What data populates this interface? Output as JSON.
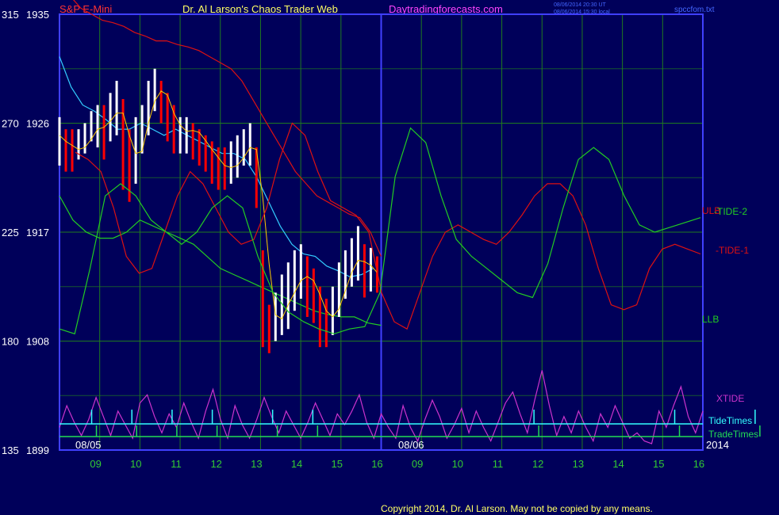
{
  "header": {
    "symbol": "S&P E-Mini",
    "title": "Dr. Al Larson's Chaos Trader Web",
    "site": "Daytradingforecasts.com",
    "stamp_utc": "08/06/2014 20:30 UT",
    "stamp_local": "08/06/2014 15:30 local",
    "file": "spccfom.txt"
  },
  "footer": {
    "copyright": "Copyright 2014, Dr. Al Larson. May not be copied by any means."
  },
  "colors": {
    "background": "#00005a",
    "grid": "#1f7a1f",
    "axis": "#4040ff",
    "upper_band": "#dd1111",
    "lower_band": "#22cc22",
    "ma_cyan": "#33ccff",
    "ma_yellow": "#ffcc00",
    "price_up": "#ffffff",
    "price_down": "#ff0000",
    "xtide": "#cc33cc",
    "tide_times": "#33ffff",
    "trade_times": "#22dd55",
    "symbol_text": "#ff3333",
    "title_text": "#ffff66",
    "site_text": "#ff44ff",
    "axis_label_text": "#ffffff"
  },
  "chart_data": {
    "type": "line",
    "y_axis_left_osc": [
      315,
      270,
      225,
      180,
      135
    ],
    "y_axis_price": [
      1935,
      1926,
      1917,
      1908,
      1899
    ],
    "ylim": [
      1899,
      1935
    ],
    "x_hour_ticks": [
      "09",
      "10",
      "11",
      "12",
      "13",
      "14",
      "15",
      "16",
      "09",
      "10",
      "11",
      "12",
      "13",
      "14",
      "15",
      "16"
    ],
    "date_labels": [
      "08/05",
      "08/06"
    ],
    "year_label": "2014",
    "series_labels": {
      "ulb": "ULB",
      "tide2": "-TIDE-2",
      "tide1": "-TIDE-1",
      "llb": "LLB",
      "xtide": "XTIDE",
      "tide_times": "TideTimes",
      "trade_times": "TradeTimes"
    },
    "hour_index_x": [
      0,
      0.5,
      1,
      1.5,
      2,
      2.5,
      3,
      3.5,
      4,
      4.5,
      5,
      5.5,
      6,
      6.5,
      7,
      7.5,
      8,
      8.5,
      9,
      9.5,
      10,
      10.5,
      11,
      11.5,
      12,
      12.5,
      13,
      13.5,
      14,
      14.5,
      15,
      15.5,
      16,
      16.5,
      17,
      17.5,
      18,
      18.5,
      19,
      19.5,
      20,
      20.5,
      21,
      21.5,
      22,
      22.5,
      23,
      23.5,
      24,
      24.5,
      25,
      25.5,
      26,
      26.5,
      27,
      27.5,
      28,
      28.5,
      29,
      29.5,
      30,
      30.5,
      31,
      31.5,
      32
    ],
    "upper_band": [
      1937,
      1936.5,
      1935.5,
      1935,
      1934.5,
      1934.3,
      1934,
      1933.5,
      1933.2,
      1932.8,
      1932.8,
      1932.5,
      1932.3,
      1932,
      1931.5,
      1931,
      1930.5,
      1929.5,
      1928,
      1926.5,
      1925,
      1923.5,
      1922,
      1921,
      1920,
      1919.5,
      1919,
      1918.5,
      1918.2,
      1917,
      1915
    ],
    "lower_band": [
      1920,
      1918,
      1917,
      1916.5,
      1916.5,
      1917,
      1918,
      1917.5,
      1917,
      1916.5,
      1916,
      1915,
      1914,
      1913.5,
      1913,
      1912.5,
      1912,
      1911.5,
      1911,
      1910.5,
      1910.2,
      1910,
      1910,
      1909.5,
      1909.3
    ],
    "ma_cyan": [
      1931.5,
      1929,
      1927.5,
      1927,
      1926.3,
      1925.5,
      1925.5,
      1926,
      1925.5,
      1925,
      1925.5,
      1925,
      1924.5,
      1924,
      1923.5,
      1923.5,
      1923,
      1921.5,
      1919.5,
      1917.5,
      1916,
      1915.2,
      1915,
      1914.2,
      1913.8,
      1913.3,
      1913.5,
      1914
    ],
    "price_close": [
      1925,
      1924,
      1923.5,
      1924,
      1924.5,
      1925.5,
      1926.5,
      1925,
      1927,
      1928.5,
      1925,
      1921.5,
      1924,
      1925.5,
      1928.5,
      1929.5,
      1928,
      1927.5,
      1925,
      1925,
      1926,
      1925.2,
      1924.5,
      1924,
      1923,
      1922.5,
      1922,
      1922.5,
      1923,
      1924,
      1925,
      1922.5,
      1912,
      1908.5,
      1910,
      1911,
      1912,
      1913,
      1914,
      1913,
      1912,
      1910.5,
      1909,
      1910.5,
      1912.5,
      1913.5,
      1915,
      1915.5,
      1913.2,
      1914.1,
      1913.7
    ],
    "price_low": [
      1922.5,
      1922,
      1922,
      1923,
      1923.5,
      1924.5,
      1924,
      1923,
      1924.5,
      1925,
      1920.5,
      1919.5,
      1921,
      1923.5,
      1925,
      1927,
      1926,
      1924.5,
      1923.5,
      1923.5,
      1923.5,
      1923,
      1922.5,
      1922,
      1921,
      1920.5,
      1920.5,
      1921,
      1921.5,
      1922.5,
      1922.5,
      1919,
      1907.5,
      1907,
      1908,
      1908.5,
      1909,
      1910.5,
      1911.5,
      1910,
      1909.5,
      1907.5,
      1907.5,
      1908.5,
      1910,
      1911.5,
      1912.5,
      1913,
      1911.6,
      1912.1,
      1912
    ],
    "price_high": [
      1926.5,
      1925.5,
      1925.5,
      1925.5,
      1926,
      1927,
      1927.5,
      1927.5,
      1928.5,
      1929.5,
      1928,
      1925.5,
      1926.5,
      1927.5,
      1929.5,
      1930.5,
      1929.5,
      1928.5,
      1927.5,
      1926.5,
      1926.5,
      1926,
      1925.5,
      1925,
      1924.5,
      1924,
      1924,
      1924.5,
      1925,
      1925.5,
      1926,
      1924,
      1915.5,
      1911,
      1912,
      1913.5,
      1914.5,
      1915.5,
      1916,
      1915,
      1914,
      1912.5,
      1911.5,
      1912.5,
      1914.5,
      1915.5,
      1916.5,
      1917.5,
      1916,
      1915.7,
      1915
    ],
    "tide1_osc": [
      258,
      255,
      250,
      235,
      215,
      208,
      210,
      225,
      240,
      250,
      245,
      235,
      225,
      220,
      222,
      235,
      255,
      270,
      265,
      250,
      238,
      235,
      232,
      225,
      200,
      188,
      185,
      200,
      215,
      225,
      228,
      225,
      222,
      220,
      225,
      232,
      240,
      245,
      245,
      240,
      228,
      210,
      195,
      193,
      195,
      210,
      218,
      220,
      218,
      216
    ],
    "tide2_osc": [
      185,
      183,
      210,
      240,
      245,
      240,
      230,
      225,
      220,
      225,
      235,
      240,
      235,
      215,
      200,
      192,
      188,
      185,
      183,
      185,
      186,
      200,
      248,
      268,
      262,
      240,
      222,
      215,
      210,
      205,
      200,
      198,
      212,
      235,
      255,
      260,
      255,
      240,
      228,
      225,
      227,
      229,
      231
    ],
    "xtide_norm": [
      0.3,
      0.7,
      0.4,
      0.15,
      0.45,
      0.85,
      0.5,
      0.15,
      0.6,
      0.35,
      0.1,
      0.75,
      0.9,
      0.5,
      0.2,
      0.55,
      0.3,
      0.75,
      0.4,
      0.1,
      0.6,
      1.0,
      0.45,
      0.1,
      0.7,
      0.35,
      0.1,
      0.45,
      0.85,
      0.5,
      0.2,
      0.6,
      0.35,
      0.1,
      0.4,
      0.75,
      0.45,
      0.15,
      0.55,
      0.35,
      0.6,
      0.9,
      0.4,
      0.1,
      0.55,
      0.3,
      0.1,
      0.7,
      0.3,
      0.05,
      0.45,
      0.8,
      0.5,
      0.1,
      0.35,
      0.65,
      0.2,
      0.6,
      0.3,
      0.05,
      0.4,
      0.75,
      0.95,
      0.55,
      0.2,
      0.8,
      1.35,
      0.7,
      0.15,
      0.5,
      0.2,
      0.6,
      0.3,
      0.05,
      0.55,
      0.3,
      0.7,
      0.4,
      0.1,
      0.2,
      0.05,
      0.0,
      0.6,
      0.3,
      0.7,
      1.05,
      0.5,
      0.2,
      0.6
    ],
    "tide_time_marks": [
      1,
      3,
      5,
      7,
      10,
      12,
      23,
      30,
      34
    ]
  }
}
